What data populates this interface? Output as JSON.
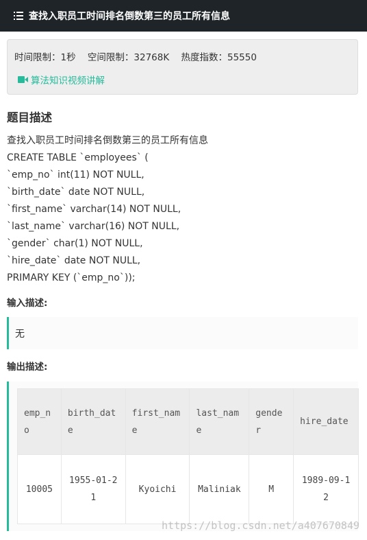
{
  "header": {
    "title": "查找入职员工时间排名倒数第三的员工所有信息",
    "icon": "list-icon"
  },
  "info": {
    "time_limit": "时间限制：1秒",
    "space_limit": "空间限制：32768K",
    "heat_index": "热度指数：55550",
    "video_link": "算法知识视频讲解",
    "accent": "#25bb9b"
  },
  "problem": {
    "title": "题目描述",
    "lines": [
      "查找入职员工时间排名倒数第三的员工所有信息",
      "CREATE TABLE `employees` (",
      "`emp_no` int(11) NOT NULL,",
      "`birth_date` date NOT NULL,",
      "`first_name` varchar(14) NOT NULL,",
      "`last_name` varchar(16) NOT NULL,",
      "`gender` char(1) NOT NULL,",
      "`hire_date` date NOT NULL,",
      "PRIMARY KEY (`emp_no`));"
    ]
  },
  "input": {
    "title": "输入描述:",
    "content": "无"
  },
  "output": {
    "title": "输出描述:",
    "headers": [
      "emp_no",
      "birth_date",
      "first_name",
      "last_name",
      "gender",
      "hire_date"
    ],
    "rows": [
      [
        "10005",
        "1955-01-21",
        "Kyoichi",
        "Maliniak",
        "M",
        "1989-09-12"
      ]
    ]
  },
  "watermark": "https://blog.csdn.net/a407670849"
}
